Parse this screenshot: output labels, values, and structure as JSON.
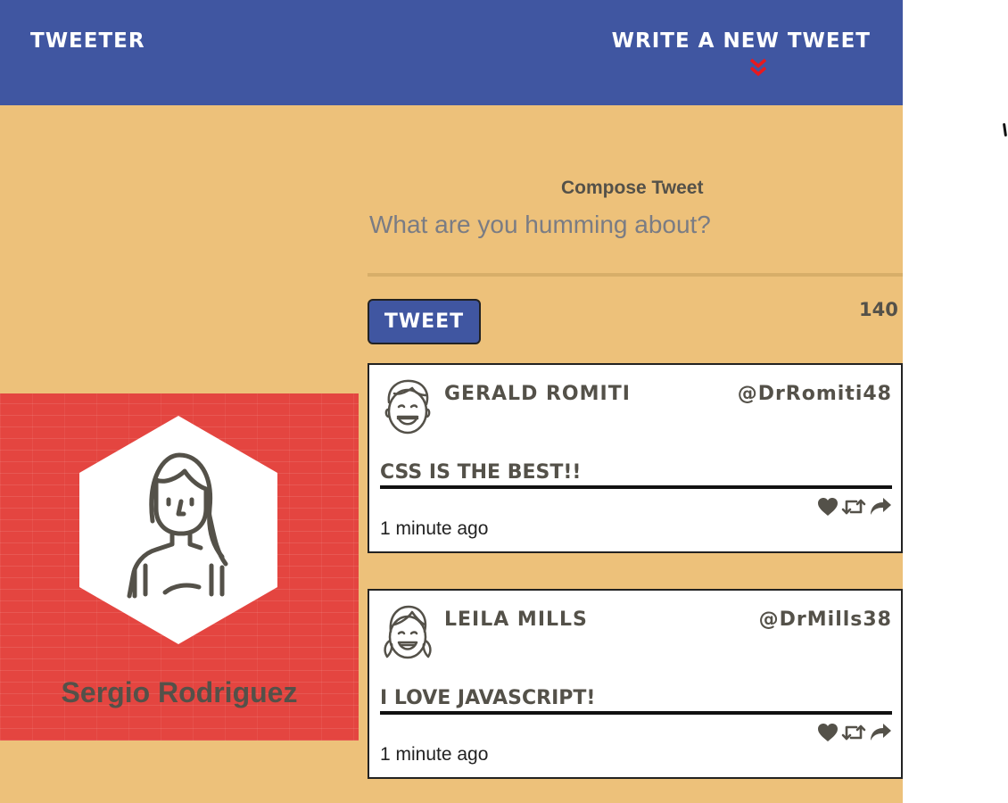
{
  "nav": {
    "brand": "TWEETER",
    "write_new": "WRITE A NEW TWEET",
    "accent_color": "#4056a1",
    "chevron_color": "#e8191e"
  },
  "profile": {
    "name": "Sergio Rodriguez",
    "background_color": "#e44540"
  },
  "composer": {
    "label": "Compose Tweet",
    "placeholder": "What are you humming about?",
    "value": "",
    "button_label": "TWEET",
    "counter": "140"
  },
  "tweets": [
    {
      "name": "GERALD ROMITI",
      "handle": "@DrRomiti48",
      "content": "CSS IS THE BEST!!",
      "time": "1 minute ago",
      "avatar_icon": "boy-avatar-icon"
    },
    {
      "name": "LEILA MILLS",
      "handle": "@DrMills38",
      "content": "I LOVE JAVASCRIPT!",
      "time": "1 minute ago",
      "avatar_icon": "girl-avatar-icon"
    }
  ],
  "colors": {
    "page_background": "#edc17a",
    "text": "#545149"
  }
}
